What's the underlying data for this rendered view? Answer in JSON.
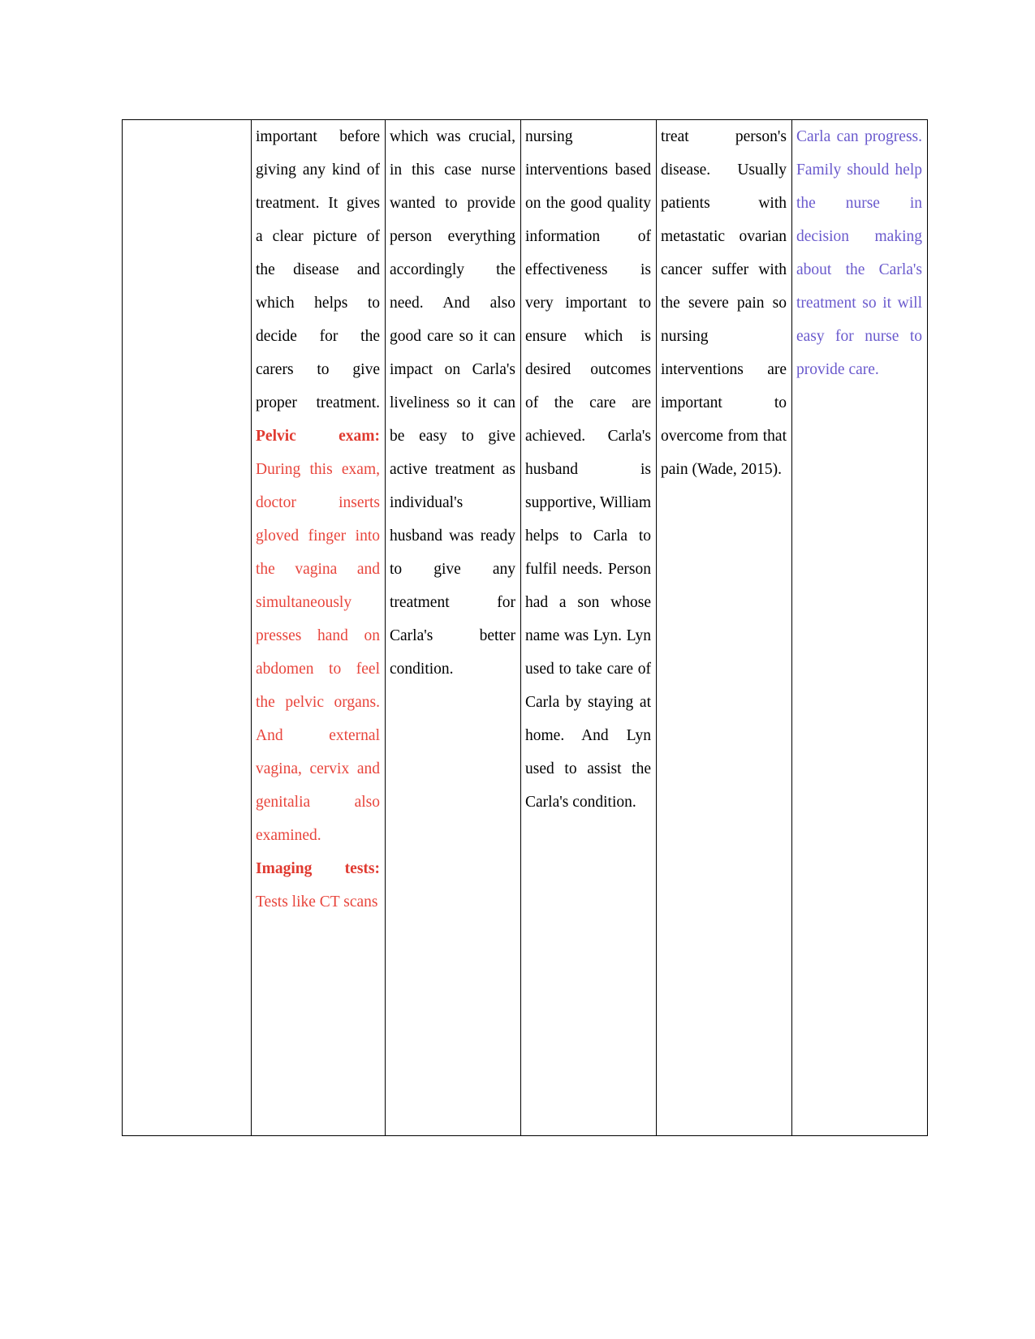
{
  "document": {
    "type": "word-processor-table-page",
    "page_background": "#ffffff",
    "border_color": "#000000",
    "colors": {
      "body_text": "#000000",
      "red_text": "#E8453C",
      "red_heading": "#E03A30",
      "purple_text": "#6A5ACD"
    }
  },
  "table": {
    "columns": 6,
    "rows": 1,
    "row": {
      "cells": [
        {
          "name": "cell-1-empty",
          "color": "body_text",
          "paragraphs": []
        },
        {
          "name": "cell-2-assessment",
          "color": "body_text",
          "paragraphs": [
            {
              "color": "#000000",
              "bold": false,
              "text": "important before giving any kind of treatment. It gives a clear picture of the disease and which helps to decide for the carers to give proper treatment."
            },
            {
              "color": "#E03A30",
              "bold": true,
              "text": "Pelvic exam:"
            },
            {
              "color": "#E8453C",
              "bold": false,
              "text": "During this exam, doctor inserts gloved finger into the vagina and simultaneously presses hand on abdomen to feel the pelvic organs. And external vagina, cervix and genitalia also examined."
            },
            {
              "color": "#E03A30",
              "bold": true,
              "text": "Imaging tests:"
            },
            {
              "color": "#E8453C",
              "bold": false,
              "text": "Tests like CT scans"
            }
          ]
        },
        {
          "name": "cell-3-nursing-care",
          "color": "body_text",
          "paragraphs": [
            {
              "color": "#000000",
              "bold": false,
              "text": "which was crucial, in this case nurse wanted to provide person everything accordingly the need. And also good care so it can impact on Carla's liveliness so it can be easy to give active treatment as individual's husband was ready to give any treatment for Carla's better condition."
            }
          ]
        },
        {
          "name": "cell-4-interventions",
          "color": "body_text",
          "paragraphs": [
            {
              "color": "#000000",
              "bold": false,
              "text": "nursing interventions based on the good quality information of effectiveness is very important to ensure which is desired outcomes of the care are achieved. Carla's husband is supportive, William helps to Carla to fulfil needs. Person had a son whose name was Lyn. Lyn used to take care of Carla by staying at home. And Lyn used to assist the Carla's condition."
            }
          ]
        },
        {
          "name": "cell-5-pain-management",
          "color": "body_text",
          "paragraphs": [
            {
              "color": "#000000",
              "bold": false,
              "text": "treat person's disease. Usually patients with metastatic ovarian cancer suffer with the severe pain so nursing interventions are important to overcome from that pain (Wade, 2015)."
            }
          ]
        },
        {
          "name": "cell-6-family-support",
          "color": "purple_text",
          "paragraphs": [
            {
              "color": "#6A5ACD",
              "bold": false,
              "text": "Carla can progress. Family should help the nurse in decision making about the Carla's treatment so it will easy for nurse to provide care."
            }
          ]
        }
      ]
    }
  }
}
